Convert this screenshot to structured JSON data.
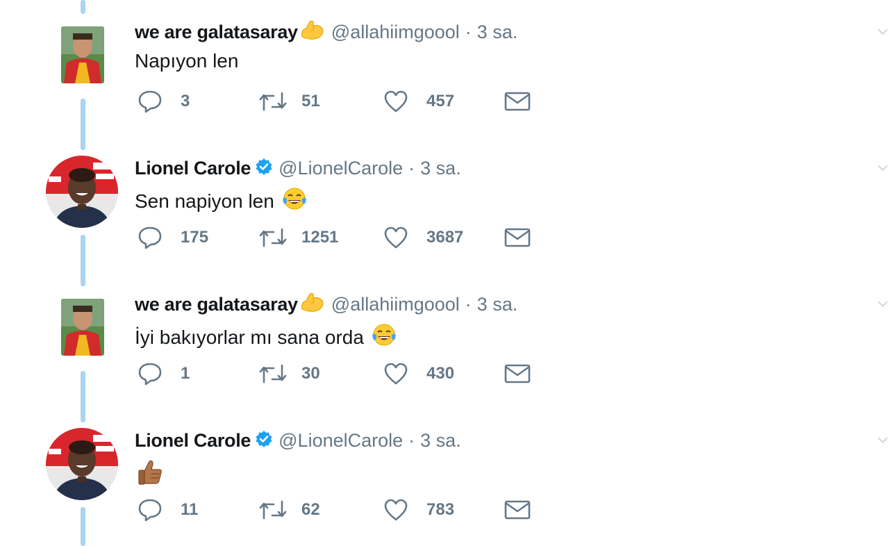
{
  "tweets": [
    {
      "author": "we are galatasaray",
      "handle": "@allahiimgoool",
      "dot": "·",
      "time": "3 sa.",
      "text": "Napıyon len",
      "text_emoji": "",
      "name_emoji": "flexed-biceps",
      "verified": false,
      "avatar": "square-avatar",
      "replies": "3",
      "retweets": "51",
      "likes": "457"
    },
    {
      "author": "Lionel Carole",
      "handle": "@LionelCarole",
      "dot": "·",
      "time": "3 sa.",
      "text": "Sen napiyon len",
      "text_emoji": "face-with-tears-of-joy",
      "name_emoji": "",
      "verified": true,
      "avatar": "round-avatar",
      "replies": "175",
      "retweets": "1251",
      "likes": "3687"
    },
    {
      "author": "we are galatasaray",
      "handle": "@allahiimgoool",
      "dot": "·",
      "time": "3 sa.",
      "text": "İyi bakıyorlar mı sana orda",
      "text_emoji": "face-with-tears-of-joy",
      "name_emoji": "flexed-biceps",
      "verified": false,
      "avatar": "square-avatar",
      "replies": "1",
      "retweets": "30",
      "likes": "430"
    },
    {
      "author": "Lionel Carole",
      "handle": "@LionelCarole",
      "dot": "·",
      "time": "3 sa.",
      "text": "",
      "text_emoji": "thumbs-up",
      "name_emoji": "",
      "verified": true,
      "avatar": "round-avatar",
      "replies": "11",
      "retweets": "62",
      "likes": "783"
    }
  ],
  "colors": {
    "thread_line": "#a9d4f3",
    "verified": "#1da1f2",
    "meta_gray": "#657786",
    "text_dark": "#14171a"
  }
}
